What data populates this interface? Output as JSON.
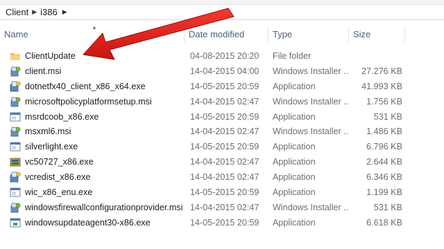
{
  "breadcrumb": [
    "Client",
    "i386"
  ],
  "columns": {
    "name": "Name",
    "date": "Date modified",
    "type": "Type",
    "size": "Size"
  },
  "files": [
    {
      "name": "ClientUpdate",
      "date": "04-08-2015 20:20",
      "type": "File folder",
      "size": "",
      "icon": "folder-icon"
    },
    {
      "name": "client.msi",
      "date": "14-04-2015 04:00",
      "type": "Windows Installer ...",
      "size": "27.276 KB",
      "icon": "installer-icon"
    },
    {
      "name": "dotnetfx40_client_x86_x64.exe",
      "date": "14-05-2015 20:59",
      "type": "Application",
      "size": "41.993 KB",
      "icon": "setup-exe-icon"
    },
    {
      "name": "microsoftpolicyplatformsetup.msi",
      "date": "14-04-2015 02:47",
      "type": "Windows Installer ...",
      "size": "1.756 KB",
      "icon": "installer-icon"
    },
    {
      "name": "msrdcoob_x86.exe",
      "date": "14-05-2015 20:59",
      "type": "Application",
      "size": "531 KB",
      "icon": "app-exe-icon"
    },
    {
      "name": "msxml6.msi",
      "date": "14-04-2015 02:47",
      "type": "Windows Installer ...",
      "size": "1.486 KB",
      "icon": "installer-icon"
    },
    {
      "name": "silverlight.exe",
      "date": "14-05-2015 20:59",
      "type": "Application",
      "size": "6.796 KB",
      "icon": "app-exe-icon"
    },
    {
      "name": "vc50727_x86.exe",
      "date": "14-04-2015 02:47",
      "type": "Application",
      "size": "2.644 KB",
      "icon": "package-exe-icon"
    },
    {
      "name": "vcredist_x86.exe",
      "date": "14-04-2015 02:47",
      "type": "Application",
      "size": "6.346 KB",
      "icon": "setup-exe-icon"
    },
    {
      "name": "wic_x86_enu.exe",
      "date": "14-05-2015 20:59",
      "type": "Application",
      "size": "1.199 KB",
      "icon": "app-exe-icon"
    },
    {
      "name": "windowsfirewallconfigurationprovider.msi",
      "date": "14-04-2015 02:47",
      "type": "Windows Installer ...",
      "size": "531 KB",
      "icon": "installer-icon"
    },
    {
      "name": "windowsupdateagent30-x86.exe",
      "date": "14-05-2015 20:59",
      "type": "Application",
      "size": "6.618 KB",
      "icon": "update-exe-icon"
    }
  ],
  "colors": {
    "arrow": "#e4201c",
    "header_text": "#4c607a",
    "detail_text": "#6d6d6d"
  }
}
